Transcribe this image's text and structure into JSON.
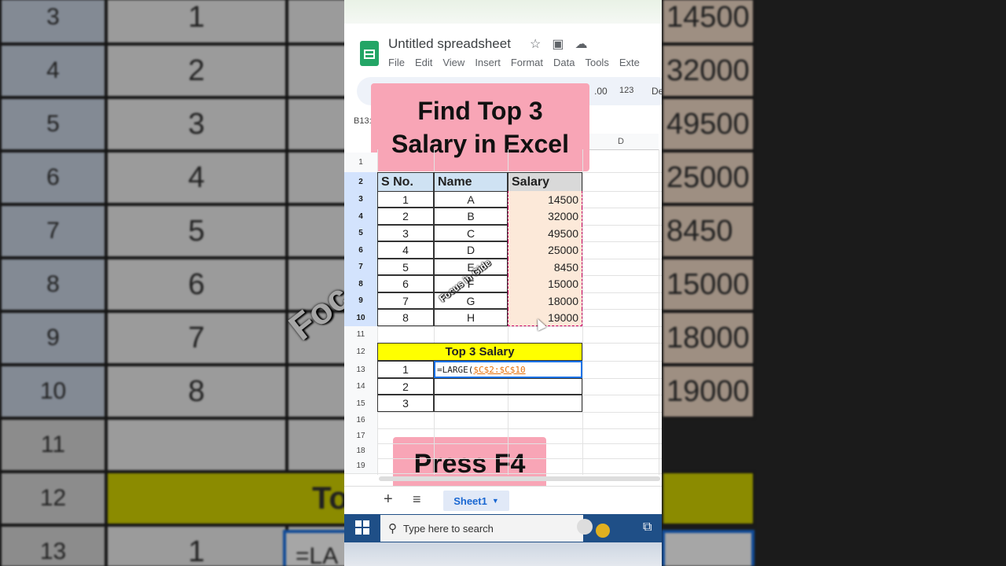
{
  "background": {
    "left_rows": [
      {
        "row": "3",
        "sno": "1"
      },
      {
        "row": "4",
        "sno": "2"
      },
      {
        "row": "5",
        "sno": "3"
      },
      {
        "row": "6",
        "sno": "4"
      },
      {
        "row": "7",
        "sno": "5"
      },
      {
        "row": "8",
        "sno": "6"
      },
      {
        "row": "9",
        "sno": "7"
      },
      {
        "row": "10",
        "sno": "8"
      },
      {
        "row": "11",
        "sno": ""
      },
      {
        "row": "12",
        "sno": ""
      },
      {
        "row": "13",
        "sno": "1"
      }
    ],
    "right_values": [
      "14500",
      "32000",
      "49500",
      "25000",
      "8450",
      "15000",
      "18000",
      "19000"
    ],
    "watermark": "Foc",
    "partial_top": "To",
    "partial_formula": "=LA"
  },
  "app": {
    "title": "Untitled spreadsheet",
    "menu": [
      "File",
      "Edit",
      "View",
      "Insert",
      "Format",
      "Data",
      "Tools",
      "Exte"
    ],
    "toolbar": {
      "decimal": ".00",
      "format123": "123",
      "font": "De"
    },
    "namebox": "B13:"
  },
  "columns": {
    "d": "D"
  },
  "rows": [
    "1",
    "2",
    "3",
    "4",
    "5",
    "6",
    "7",
    "8",
    "9",
    "10",
    "11",
    "12",
    "13",
    "14",
    "15",
    "16",
    "17",
    "18",
    "19"
  ],
  "table": {
    "headers": {
      "sno": "S No.",
      "name": "Name",
      "salary": "Salary"
    },
    "data": [
      {
        "sno": "1",
        "name": "A",
        "salary": "14500"
      },
      {
        "sno": "2",
        "name": "B",
        "salary": "32000"
      },
      {
        "sno": "3",
        "name": "C",
        "salary": "49500"
      },
      {
        "sno": "4",
        "name": "D",
        "salary": "25000"
      },
      {
        "sno": "5",
        "name": "E",
        "salary": "8450"
      },
      {
        "sno": "6",
        "name": "F",
        "salary": "15000"
      },
      {
        "sno": "7",
        "name": "G",
        "salary": "18000"
      },
      {
        "sno": "8",
        "name": "H",
        "salary": "19000"
      }
    ]
  },
  "top3": {
    "title": "Top 3 Salary",
    "ranks": [
      "1",
      "2",
      "3"
    ],
    "formula_prefix": "=LARGE(",
    "formula_ref": "$C$2:$C$10"
  },
  "overlays": {
    "heading": "Find Top 3 Salary in Excel",
    "instruction": "Press F4",
    "watermark": "Focus in Gide"
  },
  "sheet_tab": "Sheet1",
  "taskbar": {
    "search_placeholder": "Type here to search"
  },
  "colors": {
    "overlay_pink": "#f8a5b6",
    "header_blue": "#cfe2f3",
    "highlight_yellow": "#ffff00",
    "salary_fill": "#fce9d9"
  }
}
